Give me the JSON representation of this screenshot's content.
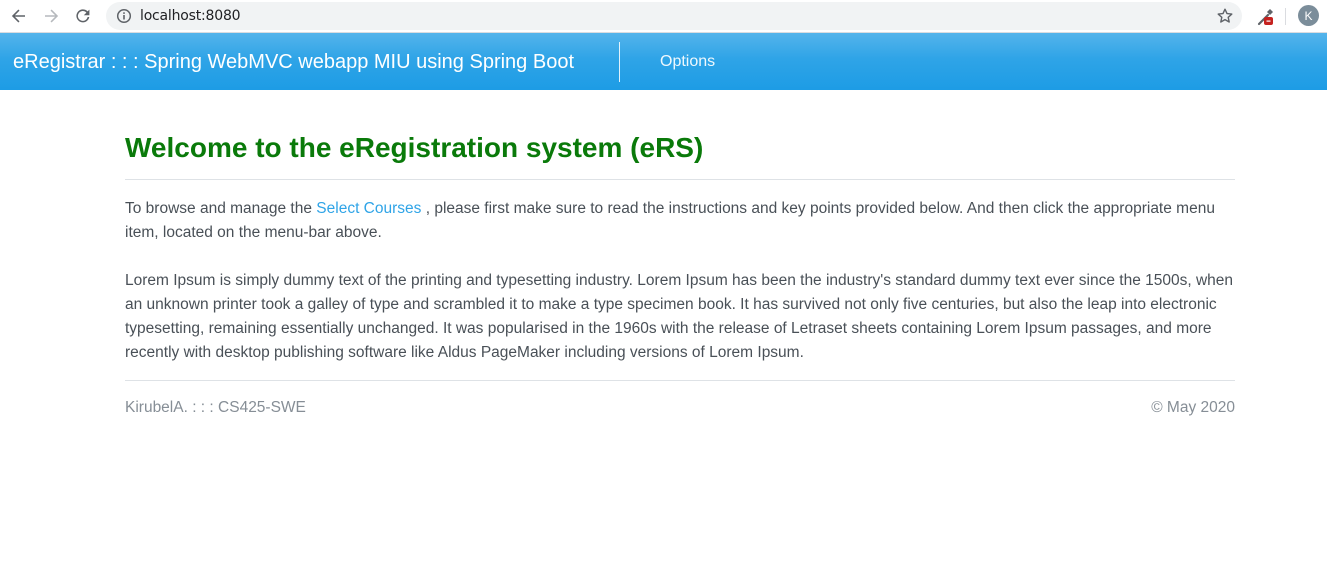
{
  "browser": {
    "url": "localhost:8080",
    "avatar_initial": "K",
    "icons": [
      "back-arrow-icon",
      "forward-arrow-icon",
      "reload-icon",
      "info-icon",
      "star-icon",
      "extension-eyedropper-icon"
    ]
  },
  "navbar": {
    "brand": "eRegistrar : : : Spring WebMVC webapp MIU using Spring Boot",
    "options_label": "Options",
    "colors": {
      "top": "#54b4eb",
      "bottom": "#1d9ce5"
    }
  },
  "main": {
    "title": "Welcome to the eRegistration system (eRS)",
    "title_color": "#0a7a0a",
    "intro_before": "To browse and manage the ",
    "intro_link": "Select Courses",
    "intro_after": " , please first make sure to read the instructions and key points provided below. And then click the appropriate menu item, located on the menu-bar above.",
    "lorem": "Lorem Ipsum is simply dummy text of the printing and typesetting industry. Lorem Ipsum has been the industry's standard dummy text ever since the 1500s, when an unknown printer took a galley of type and scrambled it to make a type specimen book. It has survived not only five centuries, but also the leap into electronic typesetting, remaining essentially unchanged. It was popularised in the 1960s with the release of Letraset sheets containing Lorem Ipsum passages, and more recently with desktop publishing software like Aldus PageMaker including versions of Lorem Ipsum."
  },
  "footer": {
    "left": "KirubelA. : : : CS425-SWE",
    "right": "© May 2020"
  }
}
